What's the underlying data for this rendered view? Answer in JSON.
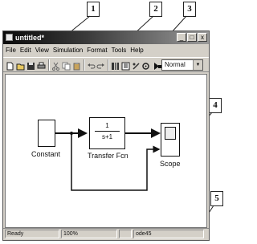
{
  "callouts": [
    "1",
    "2",
    "3",
    "4",
    "5"
  ],
  "window": {
    "title": "untitled*",
    "buttons": [
      "_",
      "□",
      "x"
    ]
  },
  "menu": [
    "File",
    "Edit",
    "View",
    "Simulation",
    "Format",
    "Tools",
    "Help"
  ],
  "toolbar": {
    "icons": [
      "new-icon",
      "open-icon",
      "save-icon",
      "print-icon",
      "cut-icon",
      "copy-icon",
      "paste-icon",
      "undo-icon",
      "redo-icon",
      "library-icon",
      "model-browser-icon",
      "debug-icon",
      "settings-icon",
      "start-icon",
      "stop-icon"
    ],
    "mode_value": "Normal"
  },
  "blocks": {
    "constant": {
      "label": "Constant"
    },
    "transfer": {
      "label": "Transfer Fcn",
      "numerator": "1",
      "denominator": "s+1"
    },
    "scope": {
      "label": "Scope"
    }
  },
  "status": {
    "ready": "Ready",
    "percent": "100%",
    "solver": "ode45"
  }
}
